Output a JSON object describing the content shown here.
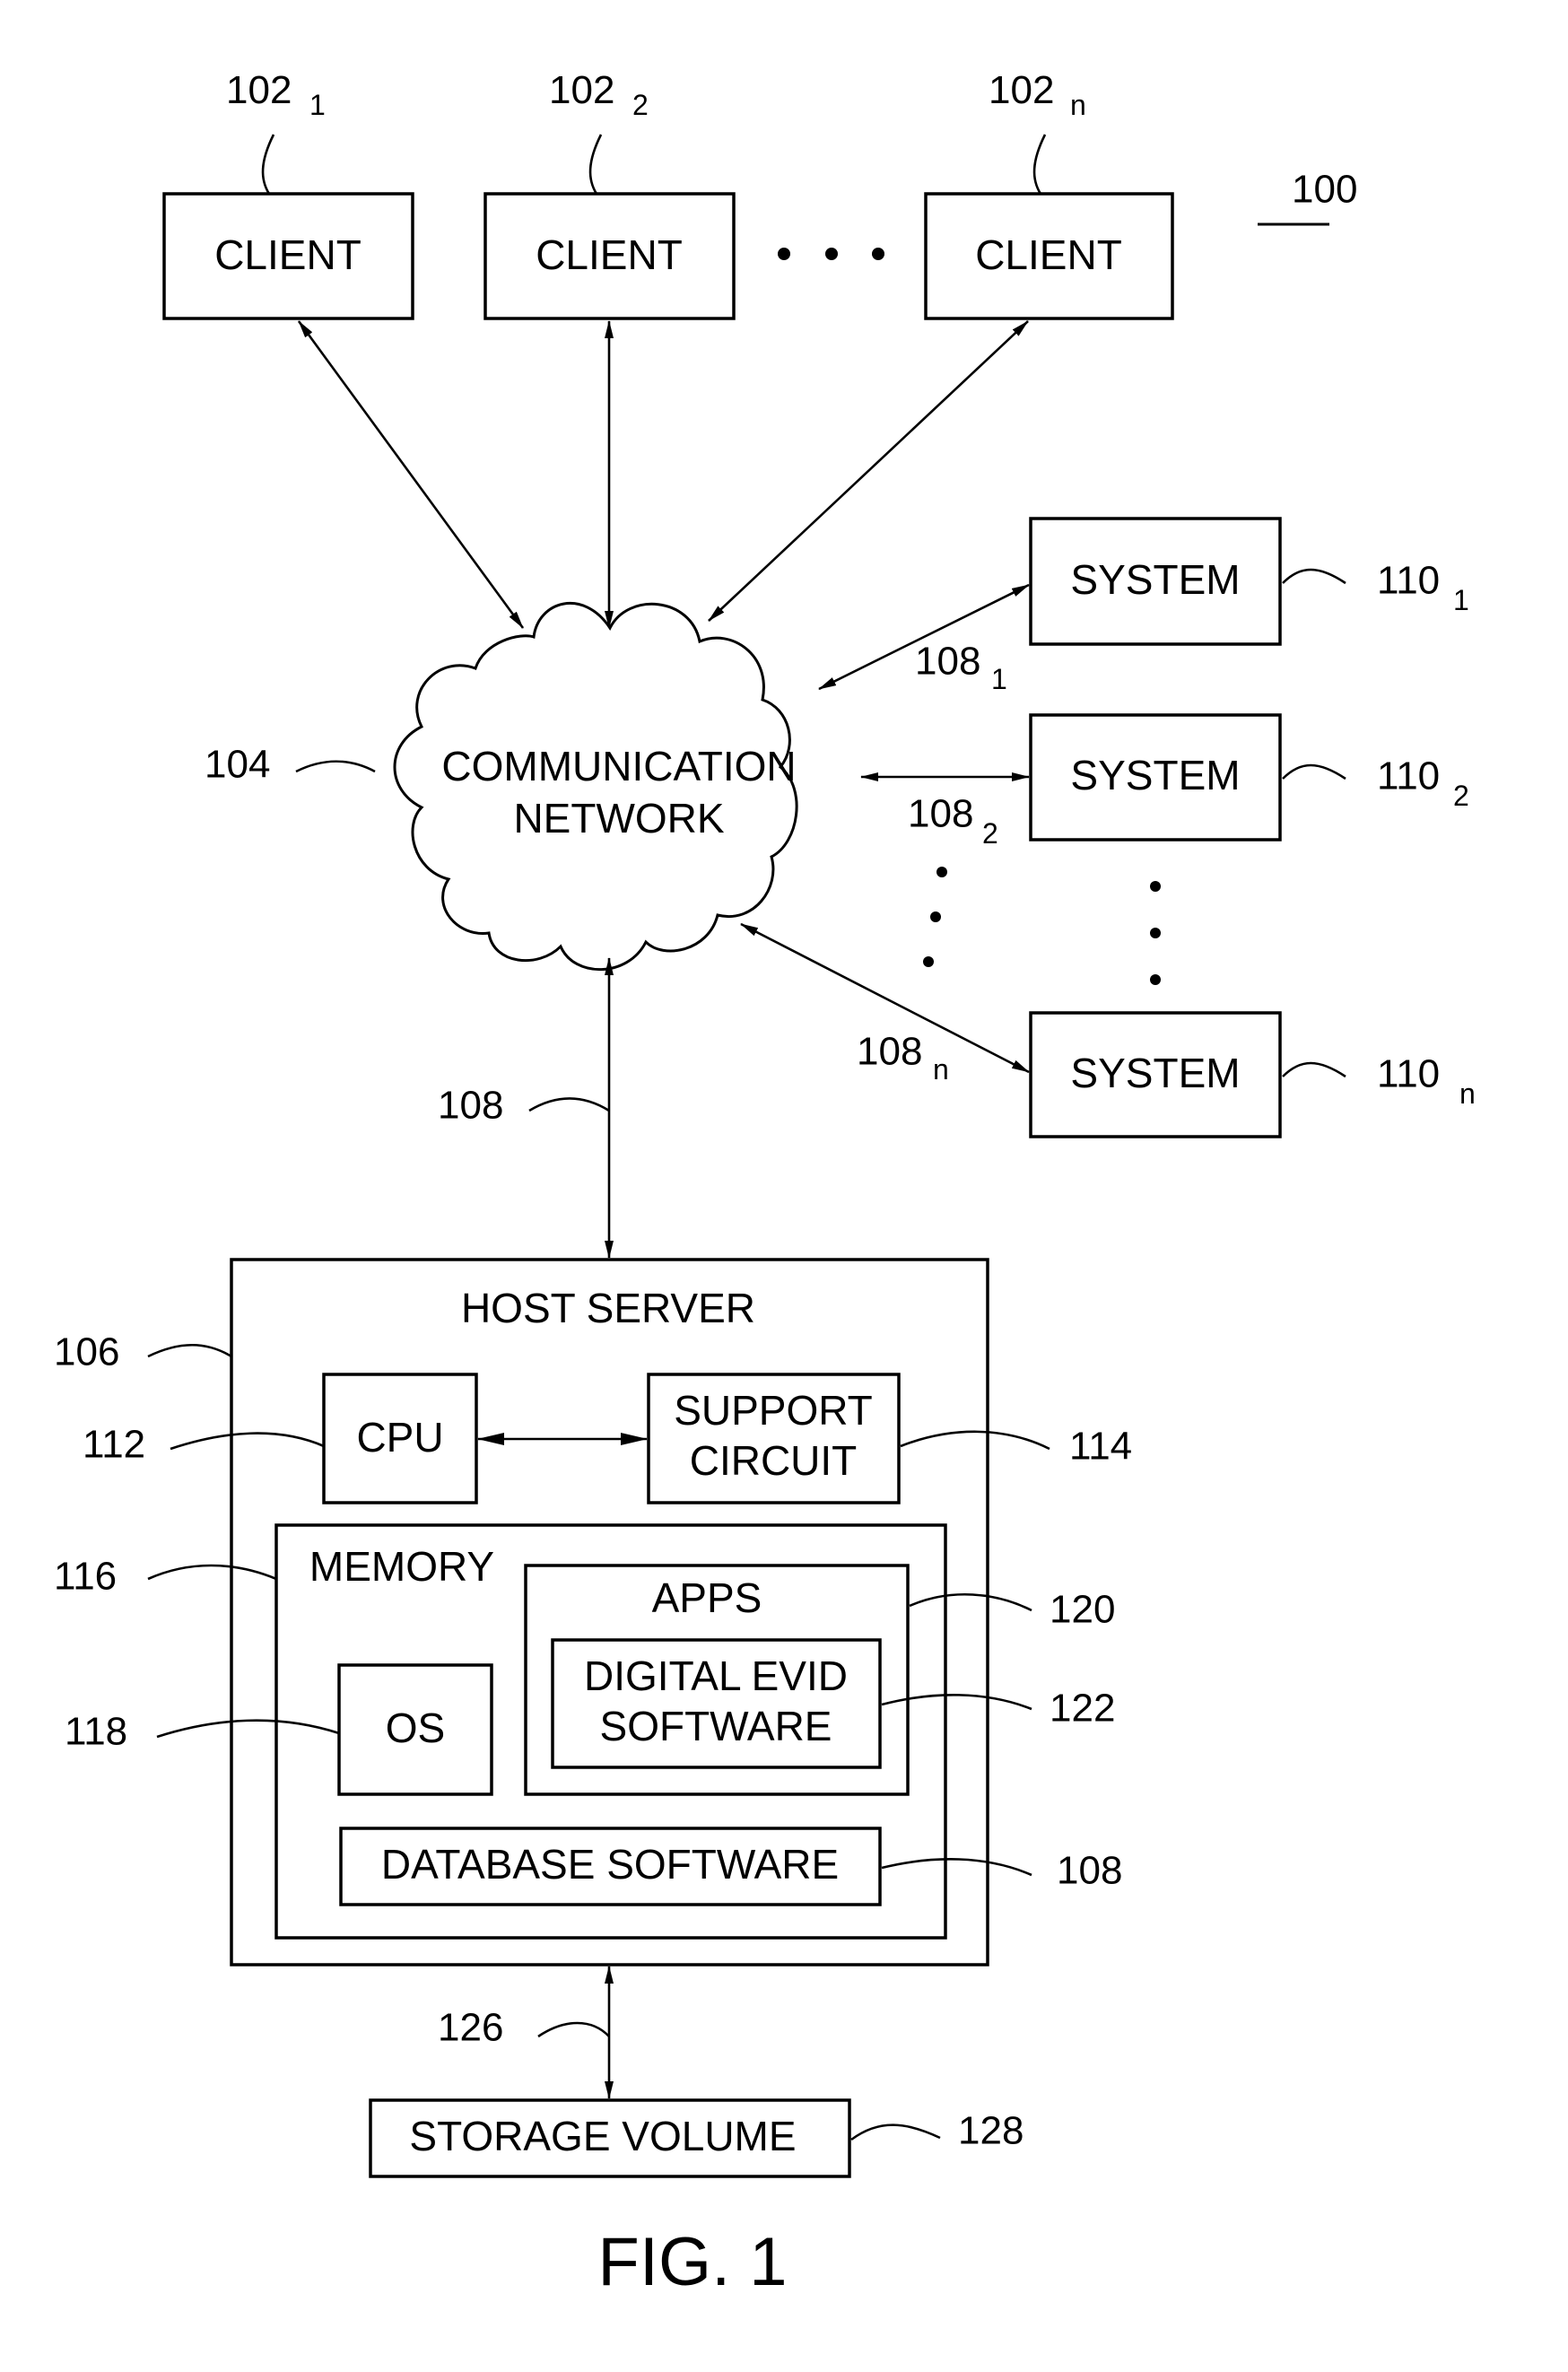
{
  "figure": {
    "caption": "FIG. 1",
    "reference": "100"
  },
  "clients": [
    {
      "label": "CLIENT",
      "ref": "102",
      "sub": "1"
    },
    {
      "label": "CLIENT",
      "ref": "102",
      "sub": "2"
    },
    {
      "label": "CLIENT",
      "ref": "102",
      "sub": "n"
    }
  ],
  "network": {
    "line1": "COMMUNICATION",
    "line2": "NETWORK",
    "ref": "104"
  },
  "systems": [
    {
      "label": "SYSTEM",
      "ref": "110",
      "sub": "1",
      "link_ref": "108",
      "link_sub": "1"
    },
    {
      "label": "SYSTEM",
      "ref": "110",
      "sub": "2",
      "link_ref": "108",
      "link_sub": "2"
    },
    {
      "label": "SYSTEM",
      "ref": "110",
      "sub": "n",
      "link_ref": "108",
      "link_sub": "n"
    }
  ],
  "host_link": {
    "ref": "108"
  },
  "host_server": {
    "title": "HOST SERVER",
    "ref": "106",
    "cpu": {
      "label": "CPU",
      "ref": "112"
    },
    "support_circuit": {
      "line1": "SUPPORT",
      "line2": "CIRCUIT",
      "ref": "114"
    },
    "memory": {
      "label": "MEMORY",
      "ref": "116",
      "os": {
        "label": "OS",
        "ref": "118"
      },
      "apps": {
        "label": "APPS",
        "ref": "120"
      },
      "digital_evid": {
        "line1": "DIGITAL EVID",
        "line2": "SOFTWARE",
        "ref": "122"
      },
      "database": {
        "label": "DATABASE SOFTWARE",
        "ref": "108"
      }
    }
  },
  "storage_link": {
    "ref": "126"
  },
  "storage": {
    "label": "STORAGE VOLUME",
    "ref": "128"
  }
}
